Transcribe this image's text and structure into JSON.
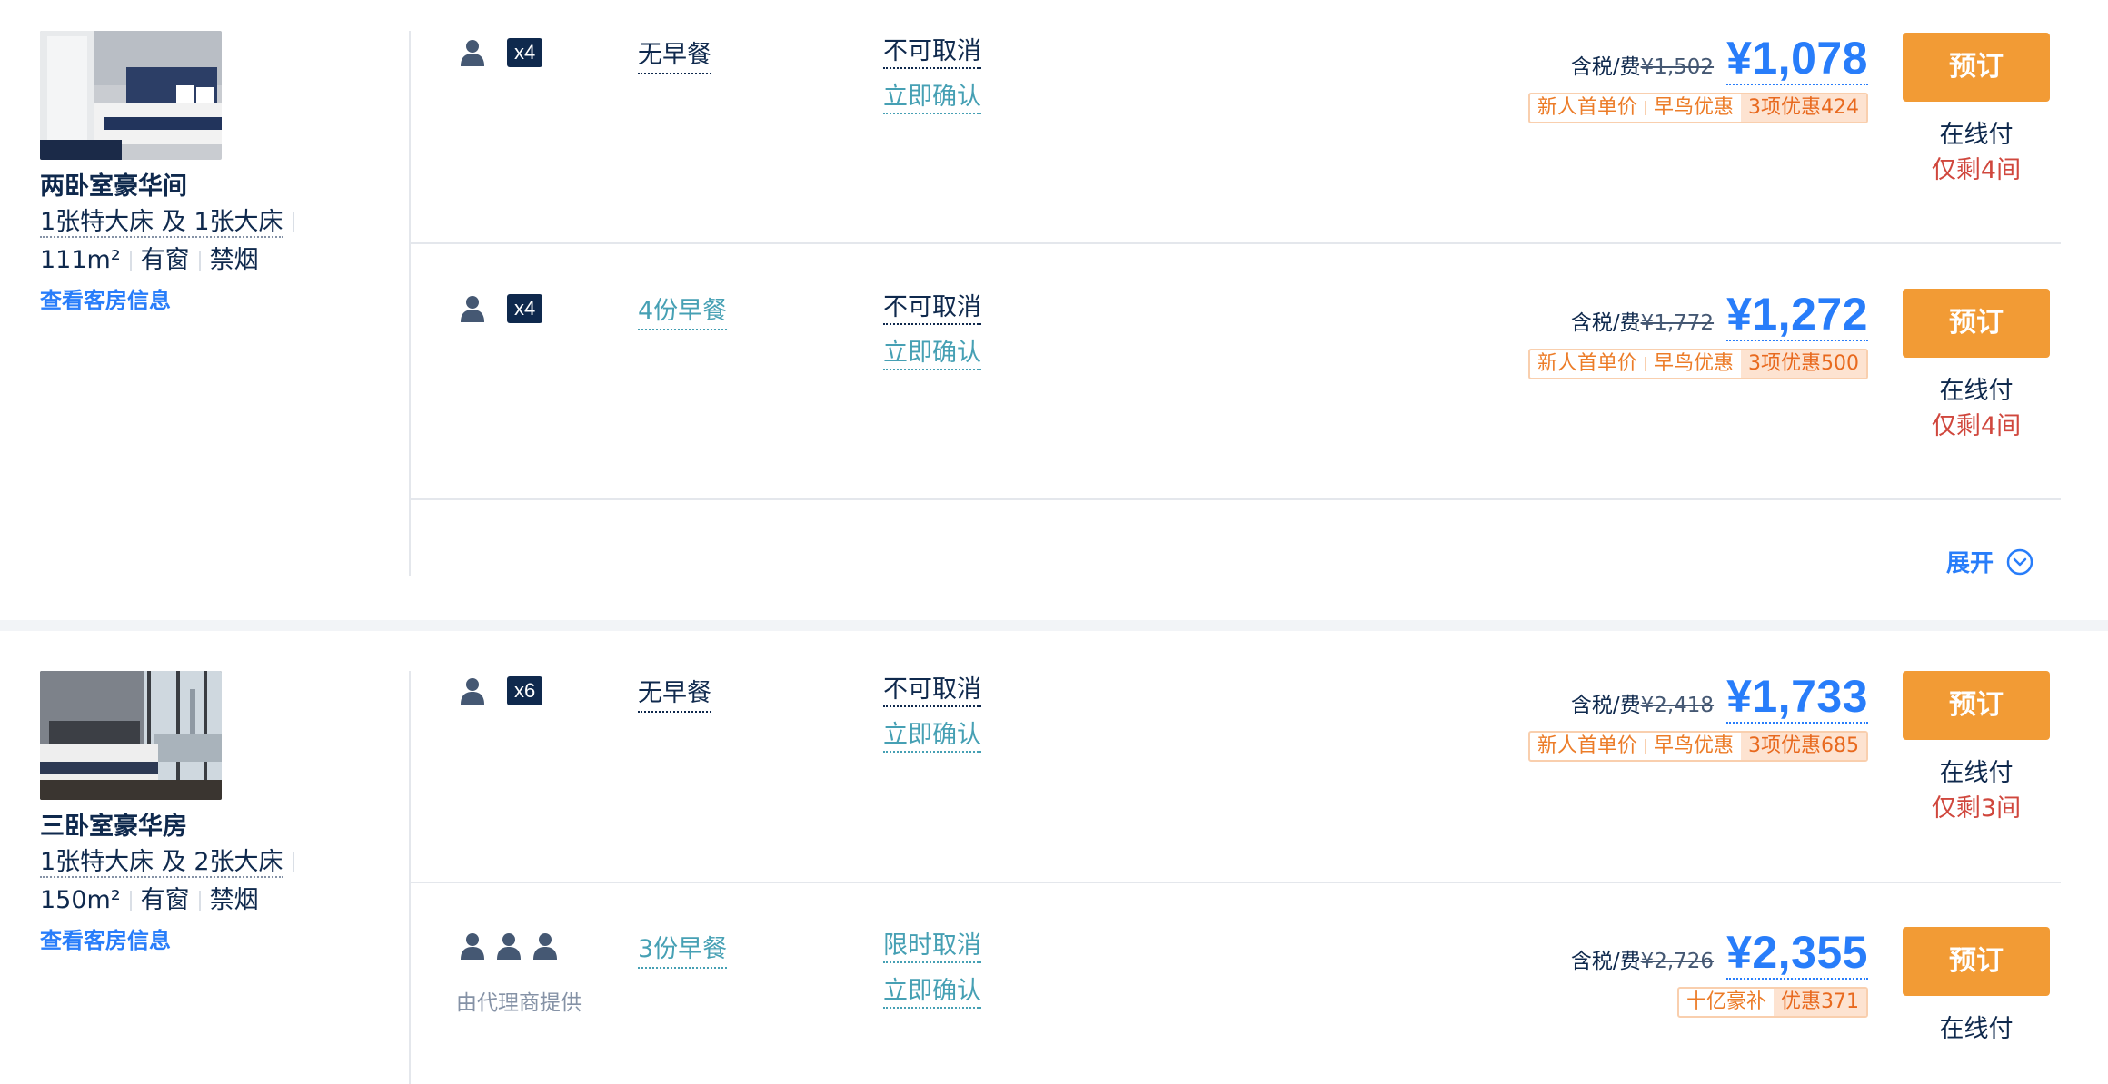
{
  "rooms": [
    {
      "name": "两卧室豪华间",
      "bed": "1张特大床 及 1张大床",
      "size": "111m²",
      "window": "有窗",
      "smoke": "禁烟",
      "link": "查看客房信息",
      "expand": "展开",
      "rates": [
        {
          "guests": "x4",
          "meal": "无早餐",
          "cancel": "不可取消",
          "confirm": "立即确认",
          "tax_label": "含税/费",
          "orig_price": "¥1,502",
          "price": "¥1,078",
          "tags": [
            "新人首单价",
            "早鸟优惠"
          ],
          "tag_hl": "3项优惠424",
          "book": "预订",
          "pay": "在线付",
          "left": "仅剩4间"
        },
        {
          "guests": "x4",
          "meal": "4份早餐",
          "cancel": "不可取消",
          "confirm": "立即确认",
          "tax_label": "含税/费",
          "orig_price": "¥1,772",
          "price": "¥1,272",
          "tags": [
            "新人首单价",
            "早鸟优惠"
          ],
          "tag_hl": "3项优惠500",
          "book": "预订",
          "pay": "在线付",
          "left": "仅剩4间"
        }
      ]
    },
    {
      "name": "三卧室豪华房",
      "bed": "1张特大床 及 2张大床",
      "size": "150m²",
      "window": "有窗",
      "smoke": "禁烟",
      "link": "查看客房信息",
      "rates": [
        {
          "guests": "x6",
          "meal": "无早餐",
          "cancel": "不可取消",
          "confirm": "立即确认",
          "tax_label": "含税/费",
          "orig_price": "¥2,418",
          "price": "¥1,733",
          "tags": [
            "新人首单价",
            "早鸟优惠"
          ],
          "tag_hl": "3项优惠685",
          "book": "预订",
          "pay": "在线付",
          "left": "仅剩3间"
        },
        {
          "guest_note": "由代理商提供",
          "meal": "3份早餐",
          "cancel": "限时取消",
          "confirm": "立即确认",
          "tax_label": "含税/费",
          "orig_price": "¥2,726",
          "price": "¥2,355",
          "tags": [
            "十亿豪补"
          ],
          "tag_hl": "优惠371",
          "book": "预订",
          "pay": "在线付"
        }
      ]
    }
  ],
  "colors": {
    "accent_blue": "#287dfa",
    "book_orange": "#f29b35",
    "teal_link": "#46a0b4",
    "warning_red": "#d0473d",
    "navy_text": "#0f294d"
  }
}
